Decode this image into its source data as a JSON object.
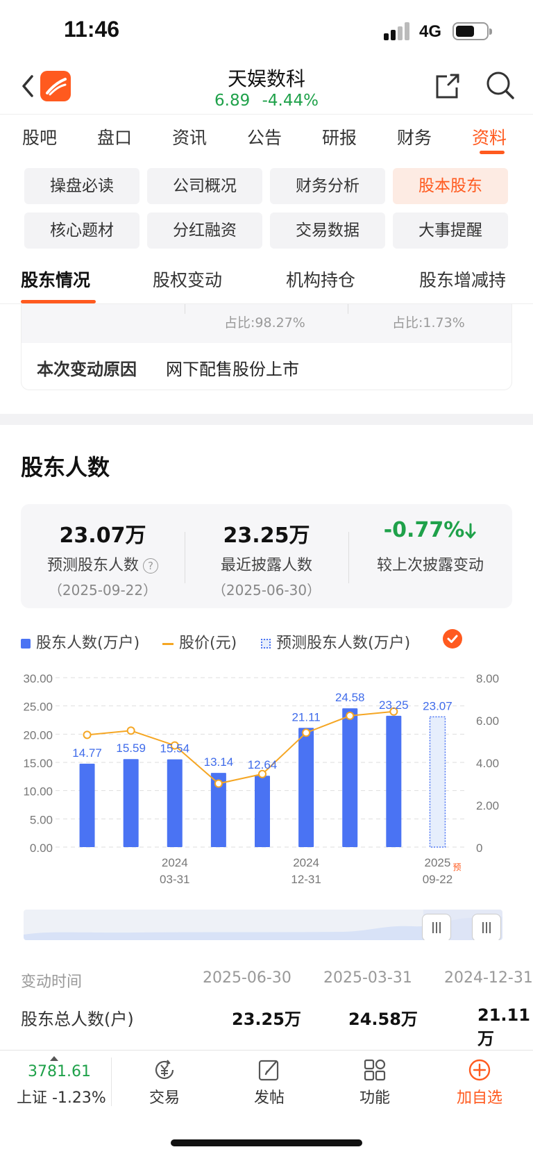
{
  "status": {
    "time": "11:46",
    "network": "4G"
  },
  "nav": {
    "stock_name": "天娱数科",
    "price": "6.89",
    "change_pct": "-4.44%"
  },
  "main_tabs": [
    {
      "label": "股吧"
    },
    {
      "label": "盘口"
    },
    {
      "label": "资讯"
    },
    {
      "label": "公告"
    },
    {
      "label": "研报"
    },
    {
      "label": "财务"
    },
    {
      "label": "资料",
      "active": true
    }
  ],
  "sub_nav": [
    {
      "label": "操盘必读"
    },
    {
      "label": "公司概况"
    },
    {
      "label": "财务分析"
    },
    {
      "label": "股本股东",
      "active": true
    },
    {
      "label": "核心题材"
    },
    {
      "label": "分红融资"
    },
    {
      "label": "交易数据"
    },
    {
      "label": "大事提醒"
    }
  ],
  "section_tabs": [
    {
      "label": "股东情况",
      "active": true
    },
    {
      "label": "股权变动"
    },
    {
      "label": "机构持仓"
    },
    {
      "label": "股东增减持"
    }
  ],
  "prev_card": {
    "ratio_a": "占比:98.27%",
    "ratio_b": "占比:1.73%",
    "reason_label": "本次变动原因",
    "reason_value": "网下配售股份上市"
  },
  "holders": {
    "title": "股东人数",
    "summary": [
      {
        "value": "23.07万",
        "label": "预测股东人数",
        "date": "（2025-09-22）"
      },
      {
        "value": "23.25万",
        "label": "最近披露人数",
        "date": "（2025-06-30）"
      },
      {
        "value": "-0.77%",
        "label": "较上次披露变动"
      }
    ],
    "legend": [
      {
        "label": "股东人数(万户)",
        "color": "#4a73f3"
      },
      {
        "label": "股价(元)",
        "color": "#f5a623"
      },
      {
        "label": "预测股东人数(万户)",
        "color": "#4a73f3"
      }
    ]
  },
  "chart_data": {
    "type": "bar",
    "categories": [
      "",
      "",
      "2024\n03-31",
      "",
      "",
      "2024\n12-31",
      "",
      "",
      "2025\n09-22"
    ],
    "series": [
      {
        "name": "股东人数(万户)",
        "values": [
          14.77,
          15.59,
          15.54,
          13.14,
          12.64,
          21.11,
          24.58,
          23.25,
          null
        ]
      },
      {
        "name": "预测股东人数(万户)",
        "values": [
          null,
          null,
          null,
          null,
          null,
          null,
          null,
          null,
          23.07
        ]
      },
      {
        "name": "股价(元)",
        "values": [
          5.3,
          5.5,
          4.8,
          3.0,
          3.45,
          5.4,
          6.2,
          6.4,
          null
        ]
      }
    ],
    "bar_labels": [
      "14.77",
      "15.59",
      "15.54",
      "13.14",
      "12.64",
      "21.11",
      "24.58",
      "23.25",
      "23.07"
    ],
    "y_left": {
      "min": 0,
      "max": 30,
      "ticks": [
        "0.00",
        "5.00",
        "10.00",
        "15.00",
        "20.00",
        "25.00",
        "30.00"
      ]
    },
    "y_right": {
      "min": 0,
      "max": 8,
      "ticks": [
        "0",
        "2.00",
        "4.00",
        "6.00",
        "8.00"
      ]
    },
    "forecast_marker": "预",
    "grid": true
  },
  "changes": {
    "label": "变动时间",
    "dates": [
      "2025-06-30",
      "2025-03-31",
      "2024-12-31"
    ],
    "total_label": "股东总人数(户)",
    "totals": [
      "23.25万",
      "24.58万",
      "21.11万"
    ]
  },
  "bottom_bar": {
    "index_value": "3781.61",
    "index_label": "上证 -1.23%",
    "items": [
      {
        "label": "交易",
        "icon": "yuan-exchange-icon"
      },
      {
        "label": "发帖",
        "icon": "compose-icon"
      },
      {
        "label": "功能",
        "icon": "grid-icon"
      },
      {
        "label": "加自选",
        "icon": "plus-circle-icon"
      }
    ]
  }
}
